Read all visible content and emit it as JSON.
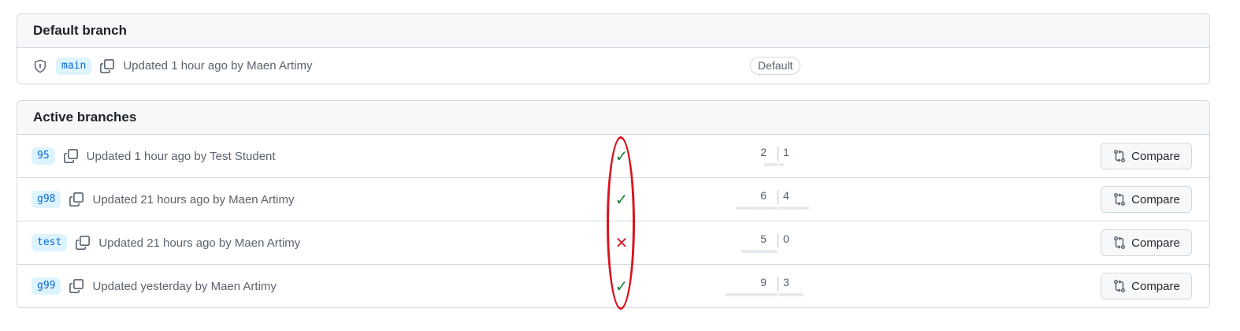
{
  "default_section": {
    "title": "Default branch",
    "branch": {
      "name": "main",
      "updated": "Updated 1 hour ago by Maen Artimy",
      "badge": "Default"
    }
  },
  "active_section": {
    "title": "Active branches",
    "branches": [
      {
        "name": "95",
        "updated": "Updated 1 hour ago by Test Student",
        "status": "success",
        "status_glyph": "✓",
        "behind": "2",
        "ahead": "1",
        "behind_fill": 0.25,
        "ahead_fill": 0.1,
        "compare_label": "Compare"
      },
      {
        "name": "g98",
        "updated": "Updated 21 hours ago by Maen Artimy",
        "status": "success",
        "status_glyph": "✓",
        "behind": "6",
        "ahead": "4",
        "behind_fill": 0.75,
        "ahead_fill": 0.55,
        "compare_label": "Compare"
      },
      {
        "name": "test",
        "updated": "Updated 21 hours ago by Maen Artimy",
        "status": "failure",
        "status_glyph": "✕",
        "behind": "5",
        "ahead": "0",
        "behind_fill": 0.65,
        "ahead_fill": 0.0,
        "compare_label": "Compare"
      },
      {
        "name": "g99",
        "updated": "Updated yesterday by Maen Artimy",
        "status": "success",
        "status_glyph": "✓",
        "behind": "9",
        "ahead": "3",
        "behind_fill": 0.95,
        "ahead_fill": 0.45,
        "compare_label": "Compare"
      }
    ]
  },
  "colors": {
    "success": "#1a7f37",
    "failure": "#cf222e",
    "annotation": "#d9131c",
    "link": "#0969da"
  },
  "icons": {
    "shield": "shield-icon",
    "copy": "copy-icon",
    "compare": "git-compare-icon"
  }
}
